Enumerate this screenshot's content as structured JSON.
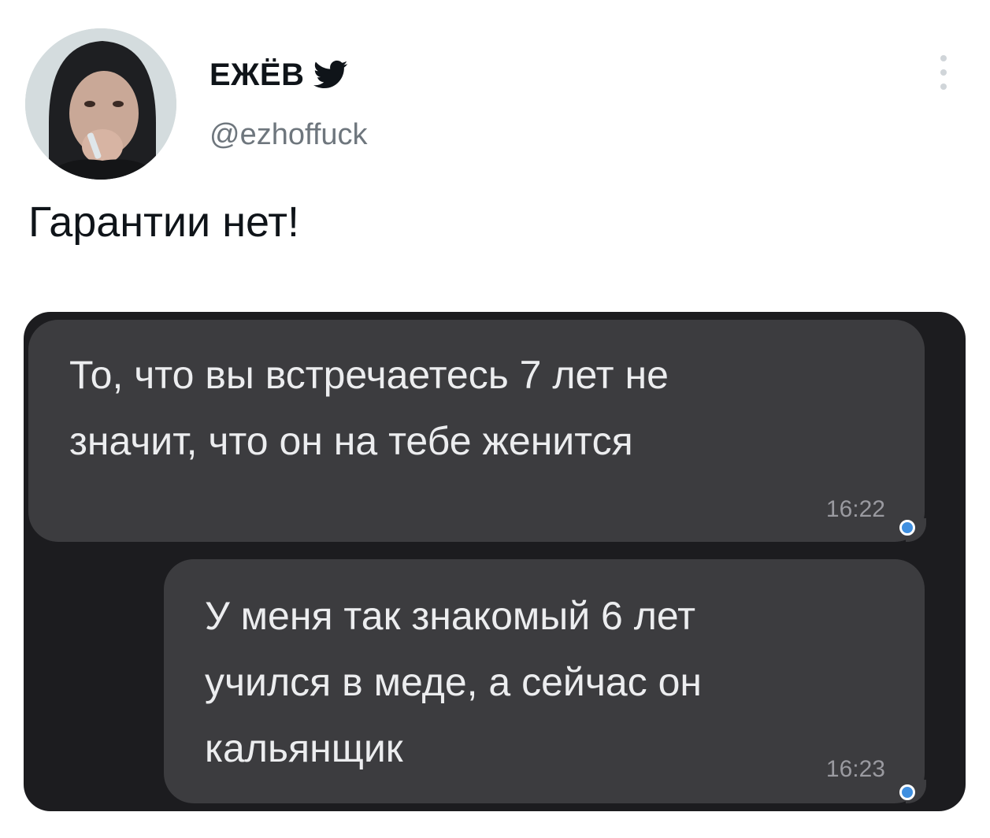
{
  "tweet": {
    "author": {
      "display_name": "ЕЖЁВ",
      "handle": "@ezhoffuck",
      "avatar_icon": "user-avatar-photo",
      "badge_icon": "twitter-bird-icon"
    },
    "menu_icon": "more-vertical-icon",
    "text": "Гарантии нет!"
  },
  "chat": {
    "background_color": "#1c1c1f",
    "bubble_color": "#3c3c3f",
    "status_dot_color": "#3f8fe0",
    "messages": [
      {
        "text": "То, что вы встречаетесь 7 лет не\nзначит, что он на тебе женится",
        "time": "16:22"
      },
      {
        "text": "У меня так знакомый 6 лет\nучился в меде, а сейчас он\nкальянщик",
        "time": "16:23"
      }
    ]
  }
}
